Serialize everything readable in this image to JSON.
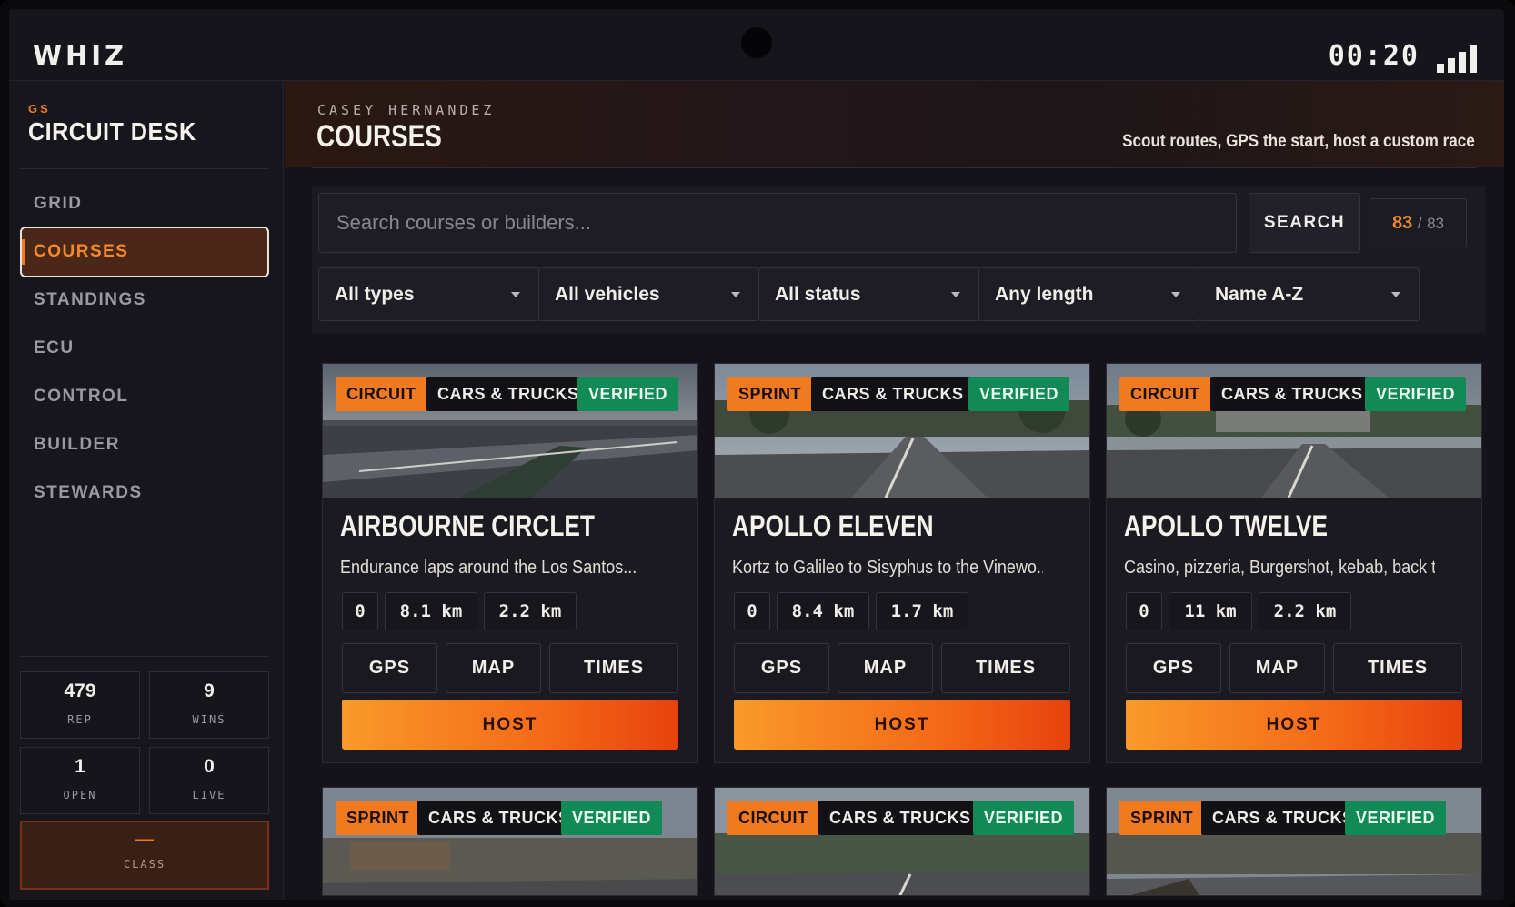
{
  "app": {
    "logo": "WHIZ",
    "clock": "00:20"
  },
  "sidebar": {
    "brand_sub": "GS",
    "brand_title": "CIRCUIT DESK",
    "nav": [
      {
        "label": "GRID",
        "active": false
      },
      {
        "label": "COURSES",
        "active": true
      },
      {
        "label": "STANDINGS",
        "active": false
      },
      {
        "label": "ECU",
        "active": false
      },
      {
        "label": "CONTROL",
        "active": false
      },
      {
        "label": "BUILDER",
        "active": false
      },
      {
        "label": "STEWARDS",
        "active": false
      }
    ],
    "stats": [
      {
        "value": "479",
        "label": "REP"
      },
      {
        "value": "9",
        "label": "WINS"
      },
      {
        "value": "1",
        "label": "OPEN"
      },
      {
        "value": "0",
        "label": "LIVE"
      }
    ],
    "class": {
      "value": "—",
      "label": "CLASS"
    }
  },
  "header": {
    "user": "CASEY HERNANDEZ",
    "title": "COURSES",
    "tagline": "Scout routes, GPS the start, host a custom race"
  },
  "search": {
    "placeholder": "Search courses or builders...",
    "value": "",
    "button": "SEARCH",
    "count_shown": "83",
    "count_sep": "/",
    "count_total": "83"
  },
  "filters": [
    {
      "selected": "All types"
    },
    {
      "selected": "All vehicles"
    },
    {
      "selected": "All status"
    },
    {
      "selected": "Any length"
    },
    {
      "selected": "Name A-Z"
    }
  ],
  "card_actions": {
    "gps": "GPS",
    "map": "MAP",
    "times": "TIMES",
    "host": "HOST"
  },
  "courses": [
    {
      "type": "CIRCUIT",
      "vehicles": "CARS & TRUCKS",
      "status": "VERIFIED",
      "name": "AIRBOURNE CIRCLET",
      "desc": "Endurance laps around the Los Santos...",
      "chips": [
        "0",
        "8.1 km",
        "2.2 km"
      ]
    },
    {
      "type": "SPRINT",
      "vehicles": "CARS & TRUCKS",
      "status": "VERIFIED",
      "name": "APOLLO ELEVEN",
      "desc": "Kortz to Galileo to Sisyphus to the Vinewo...",
      "chips": [
        "0",
        "8.4 km",
        "1.7 km"
      ]
    },
    {
      "type": "CIRCUIT",
      "vehicles": "CARS & TRUCKS",
      "status": "VERIFIED",
      "name": "APOLLO TWELVE",
      "desc": "Casino, pizzeria, Burgershot, kebab, back t...",
      "chips": [
        "0",
        "11 km",
        "2.2 km"
      ]
    },
    {
      "type": "SPRINT",
      "vehicles": "CARS & TRUCKS",
      "status": "VERIFIED"
    },
    {
      "type": "CIRCUIT",
      "vehicles": "CARS & TRUCKS",
      "status": "VERIFIED"
    },
    {
      "type": "SPRINT",
      "vehicles": "CARS & TRUCKS",
      "status": "VERIFIED"
    }
  ],
  "colors": {
    "accent": "#f07a1f",
    "verified": "#128a55",
    "active_nav_bg": "#4a2718"
  },
  "icons": {
    "signal": "signal-bars-icon",
    "caret": "caret-down-icon"
  }
}
